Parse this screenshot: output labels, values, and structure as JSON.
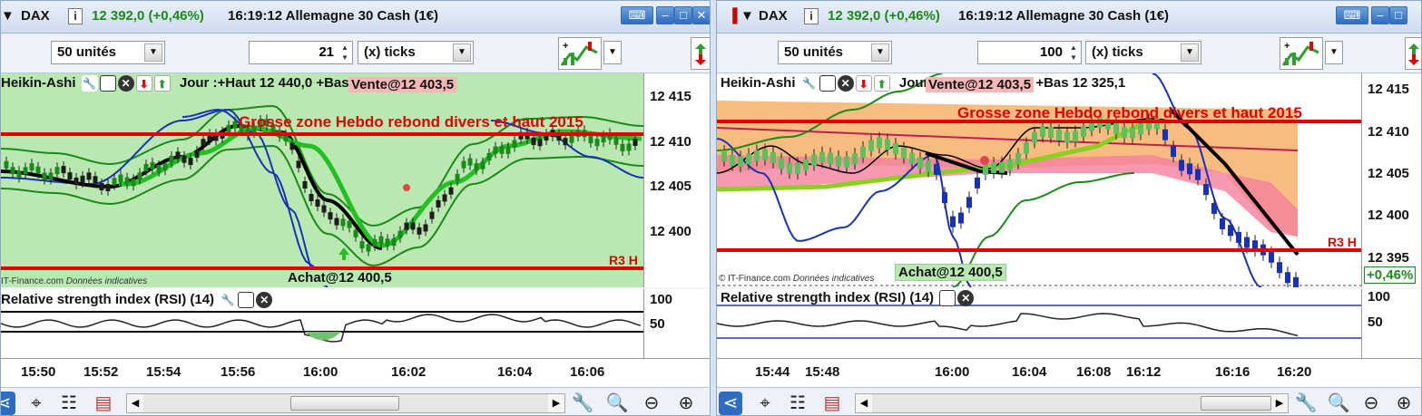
{
  "colors": {
    "bull": "#2e9e2e",
    "bear": "#1732b8",
    "level": "#e00000",
    "zone_orange": "#f8b06a",
    "zone_pink": "#f5809e",
    "left_bg": "#b9e8b0"
  },
  "left": {
    "titlebar": {
      "menu_arrow": "▼",
      "symbol": "DAX",
      "info_icon": "i",
      "quote": "12 392,0 (+0,46%)",
      "time_name": "16:19:12 Allemagne 30 Cash (1€)"
    },
    "toolbar": {
      "units": "50 unités",
      "ticks_value": "21",
      "ticks_unit": "(x) ticks"
    },
    "legend": {
      "indicator": "Heikin-Ashi",
      "daily": "Jour :+Haut 12 440,0 +Bas 12 325,1",
      "vente": "Vente@12 403,5"
    },
    "annotations": {
      "zone_text": "Grosse zone Hebdo rebond divers et haut 2015",
      "r3": "R3 H",
      "achat": "Achat@12 400,5",
      "footer": "IT-Finance.com",
      "footer_note": "Données indicatives"
    },
    "price_ticks": [
      "12 415",
      "12 410",
      "12 405",
      "12 400"
    ],
    "rsi": {
      "title": "Relative strength index (RSI) (14)",
      "ticks": [
        "100",
        "50"
      ]
    },
    "time_ticks": [
      "15:50",
      "15:52",
      "15:54",
      "15:56",
      "16:00",
      "16:02",
      "16:04",
      "16:06"
    ]
  },
  "right": {
    "titlebar": {
      "menu_arrow": "▼",
      "symbol": "DAX",
      "info_icon": "i",
      "quote": "12 392,0 (+0,46%)",
      "time_name": "16:19:12 Allemagne 30 Cash (1€)"
    },
    "toolbar": {
      "units": "50 unités",
      "ticks_value": "100",
      "ticks_unit": "(x) ticks"
    },
    "legend": {
      "indicator": "Heikin-Ashi",
      "daily": "Jour :+Haut 12 440,0 +Bas 12 325,1",
      "vente": "Vente@12 403,5"
    },
    "annotations": {
      "zone_text": "Grosse zone Hebdo rebond divers et haut 2015",
      "r3": "R3 H",
      "achat": "Achat@12 400,5",
      "footer": "© IT-Finance.com",
      "footer_note": "Données indicatives",
      "pct": "+0,46%"
    },
    "price_ticks": [
      "12 415",
      "12 410",
      "12 405",
      "12 400",
      "12 395"
    ],
    "rsi": {
      "title": "Relative strength index (RSI) (14)",
      "ticks": [
        "100",
        "50"
      ]
    },
    "time_ticks": [
      "15:44",
      "15:48",
      "16:00",
      "16:04",
      "16:08",
      "16:12",
      "16:16",
      "16:20"
    ]
  },
  "icons": {
    "share": "share-icon",
    "cursor": "cursor-icon",
    "list": "list-icon",
    "indicators": "indicators-icon",
    "zoom_fit": "zoom-fit-icon",
    "zoom_out": "zoom-out-icon",
    "zoom_in": "zoom-in-icon",
    "wrench": "wrench-icon"
  }
}
